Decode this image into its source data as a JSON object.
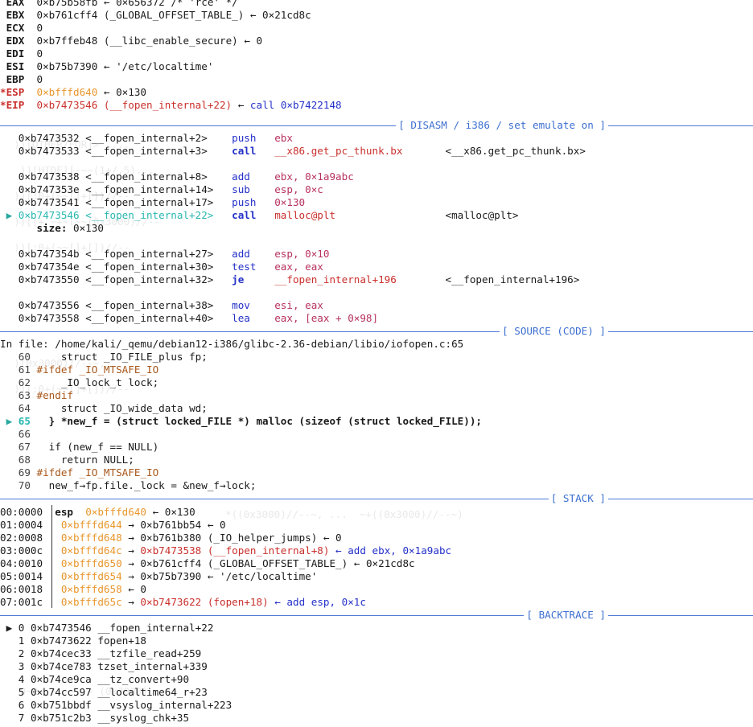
{
  "registers": [
    {
      "name": "EAX",
      "changed": false,
      "value": "0×b75b58fb",
      "rest": " ← 0×656372 /* 'rce' */"
    },
    {
      "name": "EBX",
      "changed": false,
      "value": "0×b761cff4",
      "rest": " (_GLOBAL_OFFSET_TABLE_) ← 0×21cd8c"
    },
    {
      "name": "ECX",
      "changed": false,
      "value": "0",
      "rest": ""
    },
    {
      "name": "EDX",
      "changed": false,
      "value": "0×b7ffeb48",
      "rest": " (__libc_enable_secure) ← 0"
    },
    {
      "name": "EDI",
      "changed": false,
      "value": "0",
      "rest": ""
    },
    {
      "name": "ESI",
      "changed": false,
      "value": "0×b75b7390",
      "rest": " ← '/etc/localtime'"
    },
    {
      "name": "EBP",
      "changed": false,
      "value": "0",
      "rest": ""
    },
    {
      "name": "*ESP",
      "changed": true,
      "value": "0×bfffd640",
      "rest": " ← 0×130"
    },
    {
      "name": "*EIP",
      "changed": true,
      "value": "0×b7473546 (__fopen_internal+22)",
      "rest": " ← call 0×b7422148"
    }
  ],
  "sections": {
    "disasm": "[ DISASM / i386 / set emulate on ]",
    "source": "[ SOURCE (CODE) ]",
    "stack": "[ STACK ]",
    "backtrace": "[ BACKTRACE ]"
  },
  "disasm": [
    {
      "addr": "0×b7473532 <__fopen_internal+2>",
      "mn": "push",
      "ops": "ebx",
      "tgt": ""
    },
    {
      "addr": "0×b7473533 <__fopen_internal+3>",
      "mn": "call",
      "ops": "__x86.get_pc_thunk.bx",
      "tgt": "<__x86.get_pc_thunk.bx>"
    },
    {
      "addr": "",
      "mn": "",
      "ops": "",
      "tgt": ""
    },
    {
      "addr": "0×b7473538 <__fopen_internal+8>",
      "mn": "add",
      "ops": "ebx, 0×1a9abc",
      "tgt": ""
    },
    {
      "addr": "0×b747353e <__fopen_internal+14>",
      "mn": "sub",
      "ops": "esp, 0×c",
      "tgt": ""
    },
    {
      "addr": "0×b7473541 <__fopen_internal+17>",
      "mn": "push",
      "ops": "0×130",
      "tgt": ""
    },
    {
      "addr": "0×b7473546 <__fopen_internal+22>",
      "mn": "call",
      "ops": "malloc@plt",
      "tgt": "<malloc@plt>",
      "current": true
    },
    {
      "arg": true,
      "label": "size:",
      "val": " 0×130"
    },
    {
      "addr": "",
      "mn": "",
      "ops": "",
      "tgt": ""
    },
    {
      "addr": "0×b747354b <__fopen_internal+27>",
      "mn": "add",
      "ops": "esp, 0×10",
      "tgt": ""
    },
    {
      "addr": "0×b747354e <__fopen_internal+30>",
      "mn": "test",
      "ops": "eax, eax",
      "tgt": ""
    },
    {
      "addr": "0×b7473550 <__fopen_internal+32>",
      "mn": "je",
      "ops": "__fopen_internal+196",
      "tgt": "<__fopen_internal+196>"
    },
    {
      "addr": "",
      "mn": "",
      "ops": "",
      "tgt": ""
    },
    {
      "addr": "0×b7473556 <__fopen_internal+38>",
      "mn": "mov",
      "ops": "esi, eax",
      "tgt": ""
    },
    {
      "addr": "0×b7473558 <__fopen_internal+40>",
      "mn": "lea",
      "ops": "eax, [eax + 0×98]",
      "tgt": ""
    }
  ],
  "source_file": "In file: /home/kali/_qemu/debian12-i386/glibc-2.36-debian/libio/iofopen.c:65",
  "source_lines": [
    {
      "no": "60",
      "code": "    struct _IO_FILE_plus fp;"
    },
    {
      "no": "61",
      "code": "#ifdef _IO_MTSAFE_IO"
    },
    {
      "no": "62",
      "code": "    _IO_lock_t lock;"
    },
    {
      "no": "63",
      "code": "#endif"
    },
    {
      "no": "64",
      "code": "    struct _IO_wide_data wd;"
    },
    {
      "no": "65",
      "code": "  } *new_f = (struct locked_FILE *) malloc (sizeof (struct locked_FILE));",
      "current": true
    },
    {
      "no": "66",
      "code": ""
    },
    {
      "no": "67",
      "code": "  if (new_f == NULL)"
    },
    {
      "no": "68",
      "code": "    return NULL;"
    },
    {
      "no": "69",
      "code": "#ifdef _IO_MTSAFE_IO"
    },
    {
      "no": "70",
      "code": "  new_f→fp.file._lock = &new_f→lock;"
    }
  ],
  "stack": [
    {
      "idx": "00:0000",
      "reg": "esp",
      "addr": "0×bfffd640",
      "arrow": " ← ",
      "val": "0×130",
      "valcolor": "dk",
      "rest": ""
    },
    {
      "idx": "01:0004",
      "reg": "",
      "addr": "0×bfffd644",
      "arrow": " → ",
      "val": "0×b761bb54",
      "valcolor": "dk",
      "rest": " ← 0"
    },
    {
      "idx": "02:0008",
      "reg": "",
      "addr": "0×bfffd648",
      "arrow": " → ",
      "val": "0×b761b380",
      "valcolor": "dk",
      "rest": " (_IO_helper_jumps) ← 0"
    },
    {
      "idx": "03:000c",
      "reg": "",
      "addr": "0×bfffd64c",
      "arrow": " → ",
      "val": "0×b7473538 (__fopen_internal+8)",
      "valcolor": "red",
      "rest": " ← add ebx, 0×1a9abc"
    },
    {
      "idx": "04:0010",
      "reg": "",
      "addr": "0×bfffd650",
      "arrow": " → ",
      "val": "0×b761cff4",
      "valcolor": "dk",
      "rest": " (_GLOBAL_OFFSET_TABLE_) ← 0×21cd8c"
    },
    {
      "idx": "05:0014",
      "reg": "",
      "addr": "0×bfffd654",
      "arrow": " → ",
      "val": "0×b75b7390",
      "valcolor": "dk",
      "rest": " ← '/etc/localtime'"
    },
    {
      "idx": "06:0018",
      "reg": "",
      "addr": "0×bfffd658",
      "arrow": " ← ",
      "val": "0",
      "valcolor": "dk",
      "rest": ""
    },
    {
      "idx": "07:001c",
      "reg": "",
      "addr": "0×bfffd65c",
      "arrow": " → ",
      "val": "0×b7473622 (fopen+18)",
      "valcolor": "red",
      "rest": " ← add esp, 0×1c"
    }
  ],
  "backtrace": [
    {
      "n": "0",
      "addr": "0×b7473546",
      "fn": "__fopen_internal+22",
      "current": true
    },
    {
      "n": "1",
      "addr": "0×b7473622",
      "fn": "fopen+18"
    },
    {
      "n": "2",
      "addr": "0×b74cec33",
      "fn": "__tzfile_read+259"
    },
    {
      "n": "3",
      "addr": "0×b74ce783",
      "fn": "tzset_internal+339"
    },
    {
      "n": "4",
      "addr": "0×b74ce9ca",
      "fn": "__tz_convert+90"
    },
    {
      "n": "5",
      "addr": "0×b74cc597",
      "fn": "__localtime64_r+23"
    },
    {
      "n": "6",
      "addr": "0×b751bbdf",
      "fn": "__vsyslog_internal+223"
    },
    {
      "n": "7",
      "addr": "0×b751c2b3",
      "fn": "__syslog_chk+35"
    }
  ]
}
